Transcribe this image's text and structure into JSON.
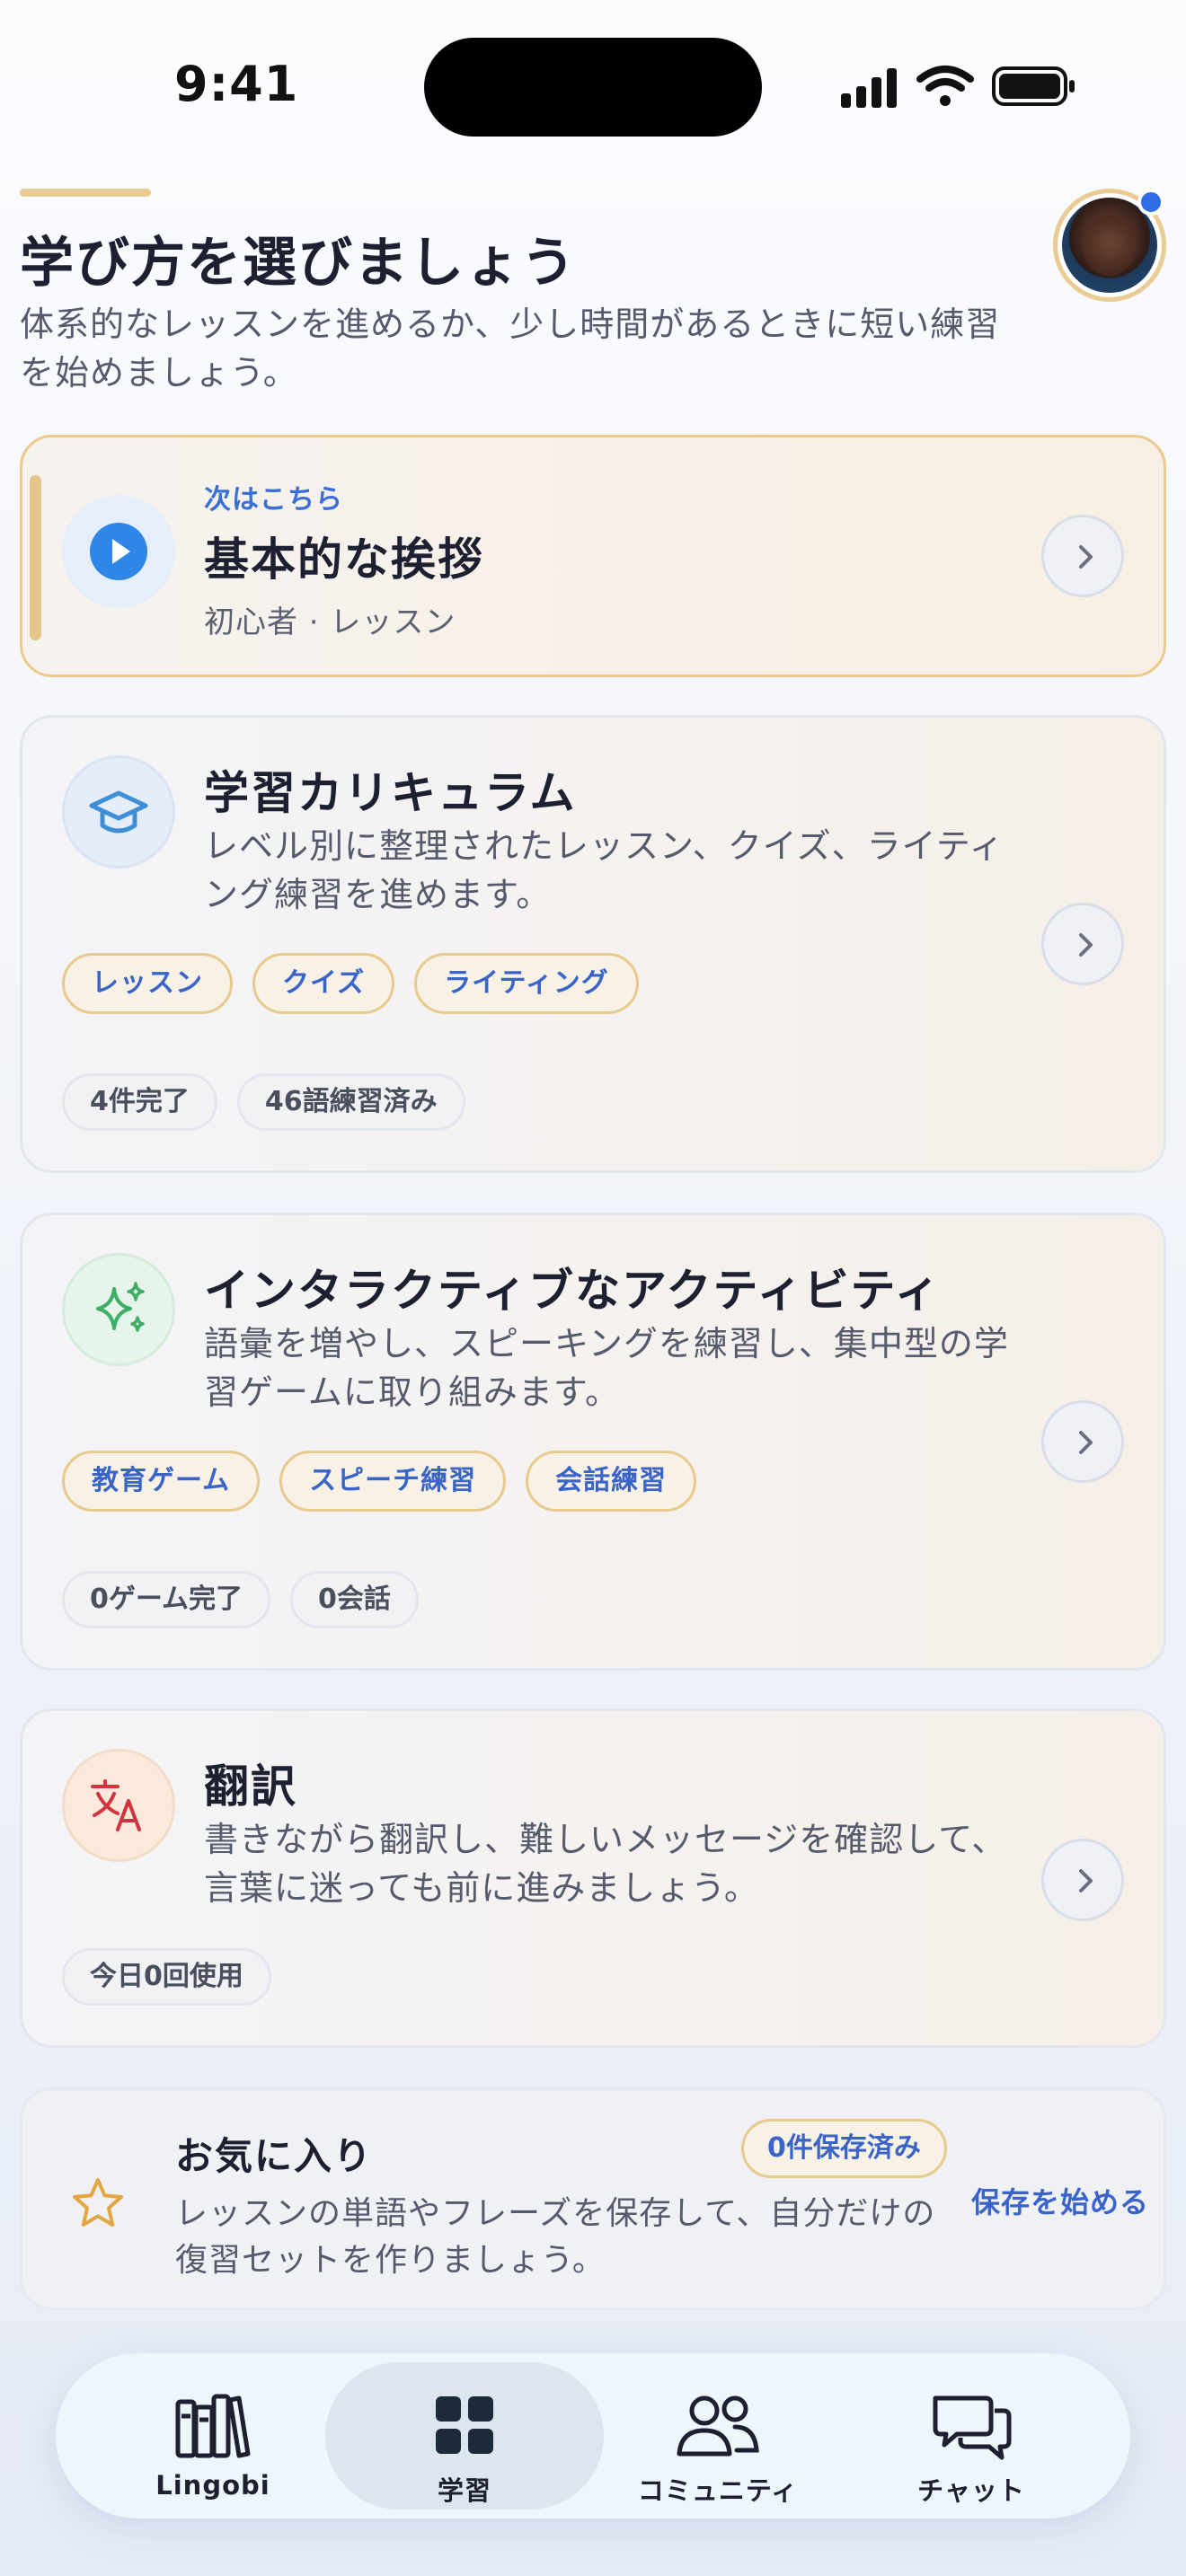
{
  "status_bar": {
    "time": "9:41"
  },
  "header": {
    "title": "学び方を選びましょう",
    "subtitle": "体系的なレッスンを進めるか、少し時間があるときに短い練習を始めましょう。"
  },
  "next_up": {
    "label": "次はこちら",
    "title": "基本的な挨拶",
    "meta": "初心者 · レッスン"
  },
  "curriculum": {
    "title": "学習カリキュラム",
    "description": "レベル別に整理されたレッスン、クイズ、ライティング練習を進めます。",
    "chips": [
      "レッスン",
      "クイズ",
      "ライティング"
    ],
    "stats": [
      "4件完了",
      "46語練習済み"
    ]
  },
  "activities": {
    "title": "インタラクティブなアクティビティ",
    "description": "語彙を増やし、スピーキングを練習し、集中型の学習ゲームに取り組みます。",
    "chips": [
      "教育ゲーム",
      "スピーチ練習",
      "会話練習"
    ],
    "stats": [
      "0ゲーム完了",
      "0会話"
    ]
  },
  "translation": {
    "title": "翻訳",
    "description": "書きながら翻訳し、難しいメッセージを確認して、言葉に迷っても前に進みましょう。",
    "stats": [
      "今日0回使用"
    ]
  },
  "favorites": {
    "title": "お気に入り",
    "badge": "0件保存済み",
    "description": "レッスンの単語やフレーズを保存して、自分だけの復習セットを作りましょう。",
    "link": "保存を始める"
  },
  "tabbar": {
    "items": [
      {
        "label": "Lingobi",
        "icon": "library-icon"
      },
      {
        "label": "学習",
        "icon": "grid-icon",
        "active": true
      },
      {
        "label": "コミュニティ",
        "icon": "people-icon"
      },
      {
        "label": "チャット",
        "icon": "chat-icon"
      }
    ]
  },
  "colors": {
    "accent_gold": "#e9cb93",
    "link_blue": "#3a64c8",
    "play_blue": "#2f86e6",
    "notification_dot": "#2f6de8"
  }
}
